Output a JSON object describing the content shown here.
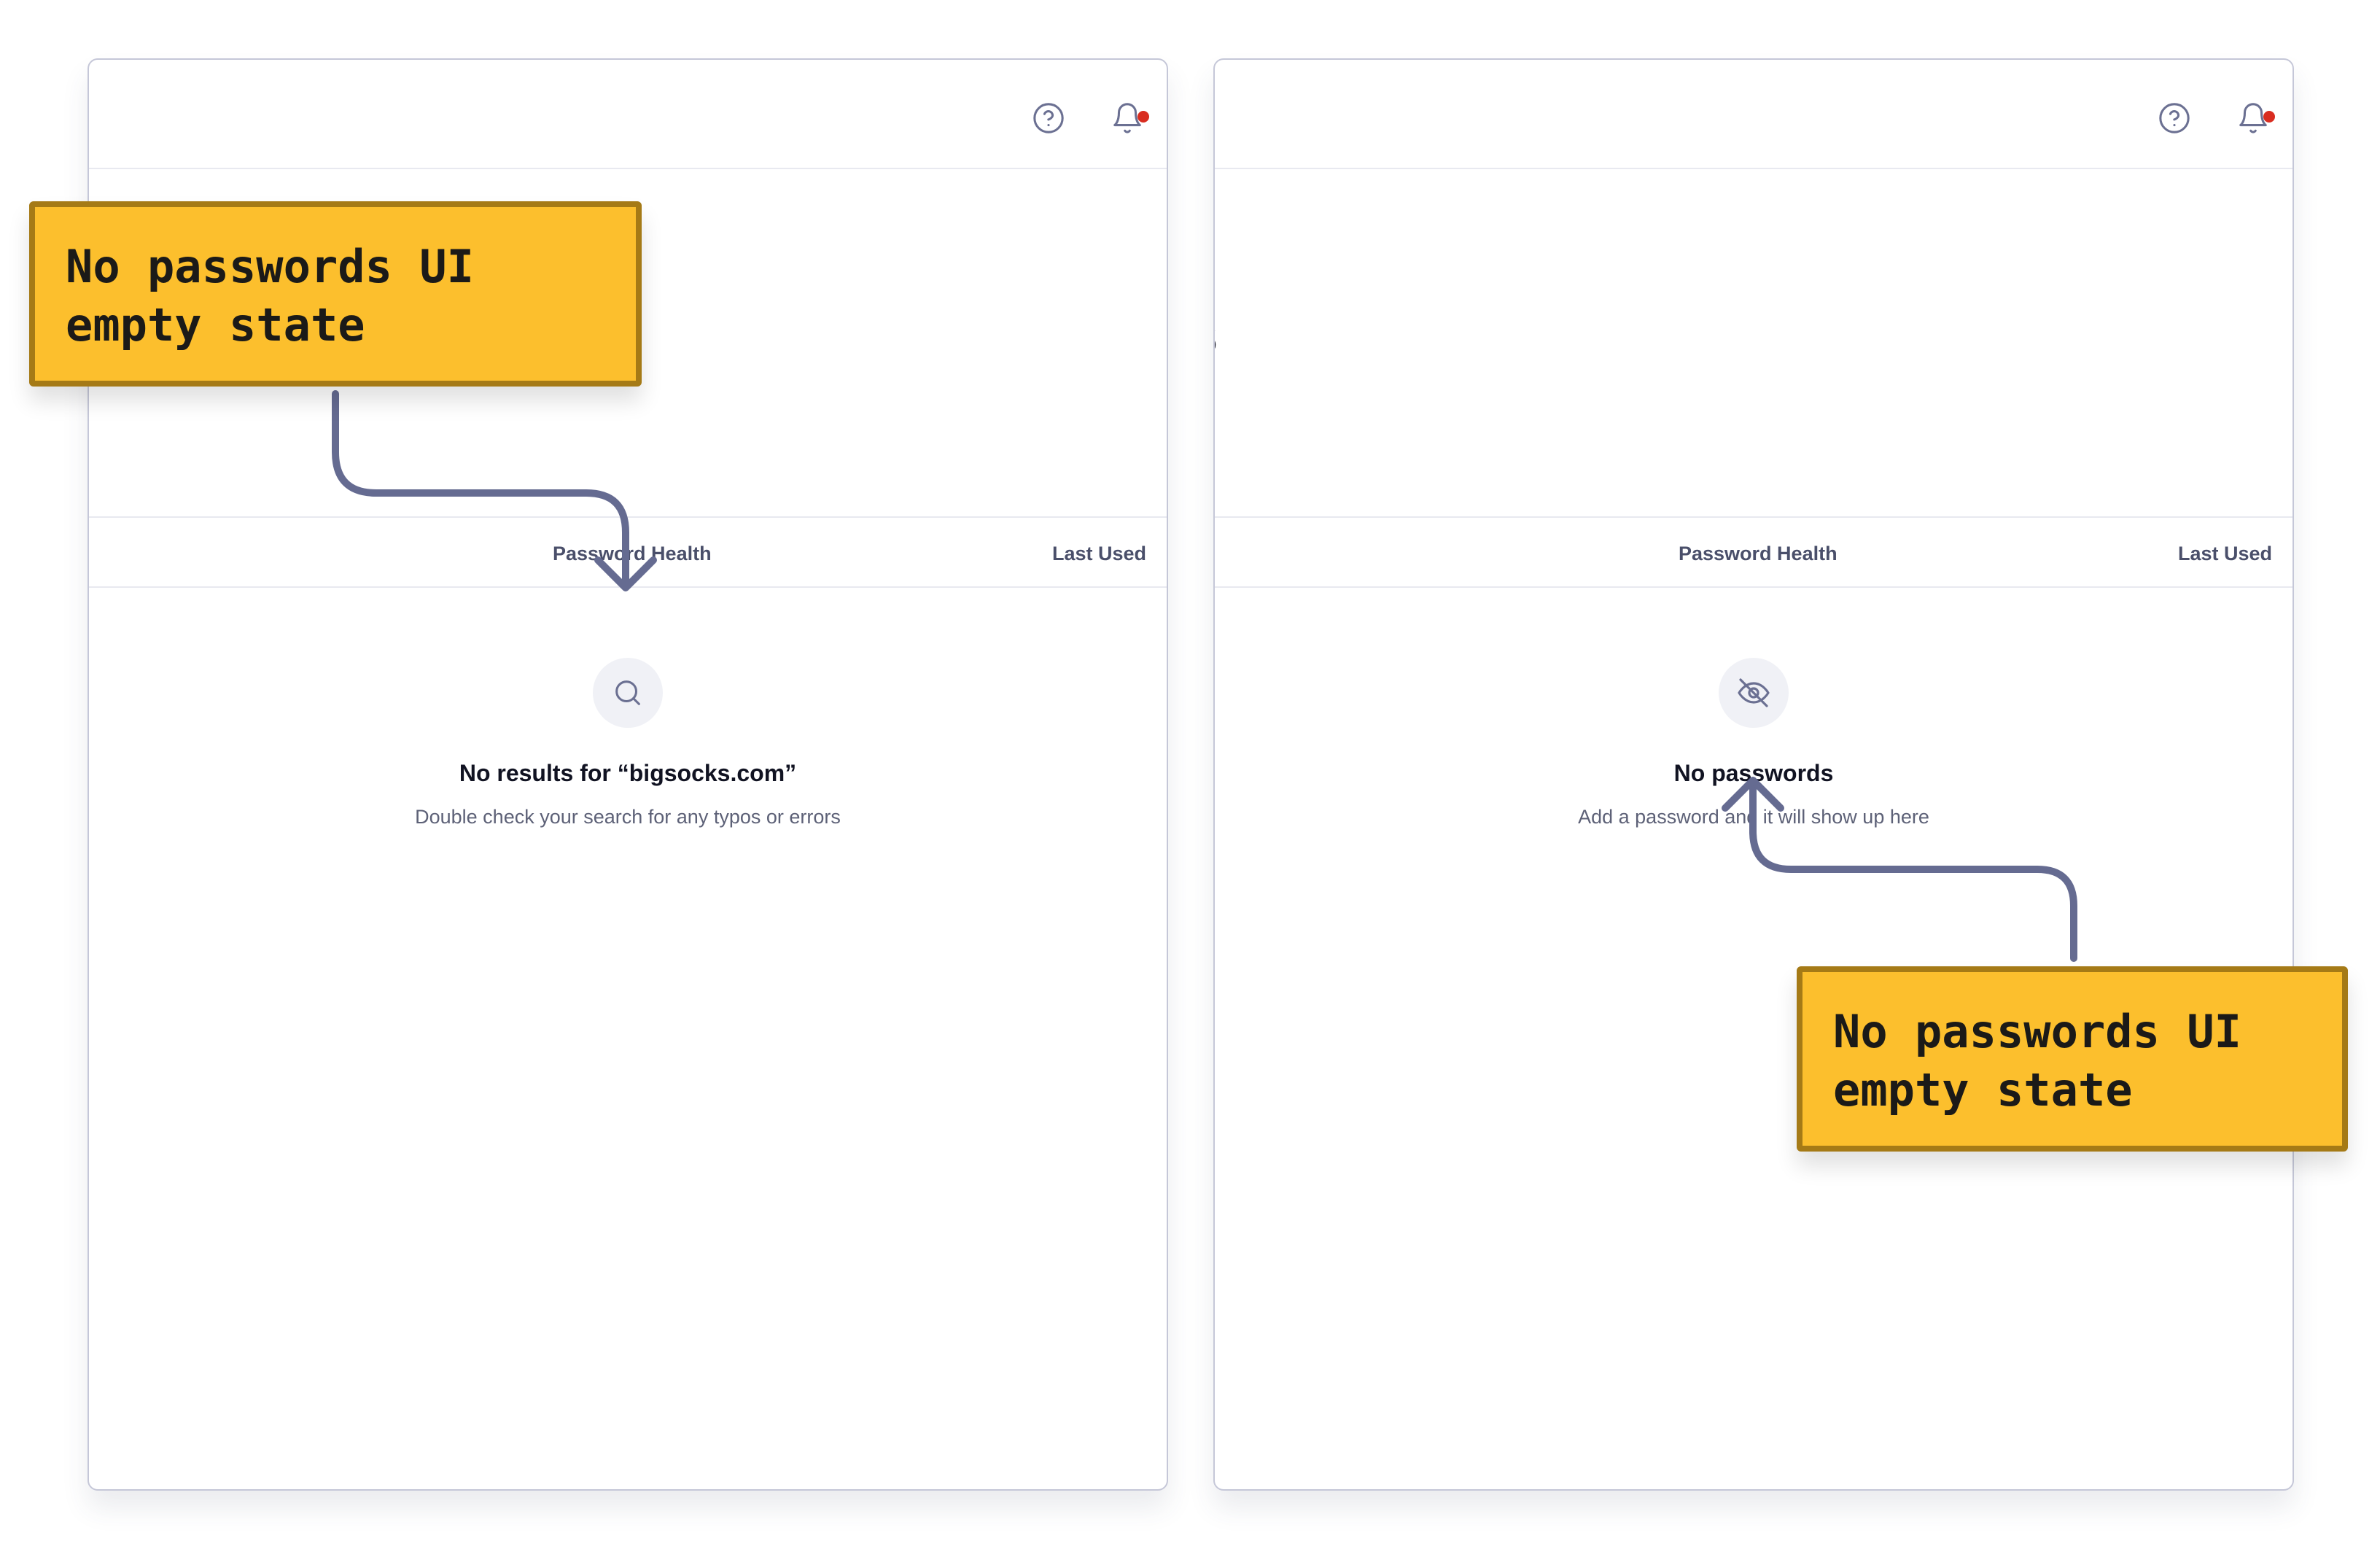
{
  "panels": [
    {
      "heading_fragment": "",
      "columns": {
        "health": "Password Health",
        "last_used": "Last Used"
      },
      "empty_state": {
        "icon": "search-icon",
        "title": "No results for “bigsocks.com”",
        "subtitle": "Double check your search for any typos or errors"
      }
    },
    {
      "heading_fragment": "s",
      "columns": {
        "health": "Password Health",
        "last_used": "Last Used"
      },
      "empty_state": {
        "icon": "eye-off-icon",
        "title": "No passwords",
        "subtitle": "Add a password and it will show up here"
      }
    }
  ],
  "header_icons": [
    "help-circle-icon",
    "bell-icon"
  ],
  "callouts": [
    {
      "line1": "No passwords UI",
      "line2": "empty state"
    },
    {
      "line1": "No passwords UI",
      "line2": "empty state"
    }
  ],
  "colors": {
    "callout_fill": "#fcbf2d",
    "callout_border": "#a57a16",
    "arrow": "#656b91",
    "notification_dot": "#d92d20",
    "icon": "#6b7092"
  }
}
